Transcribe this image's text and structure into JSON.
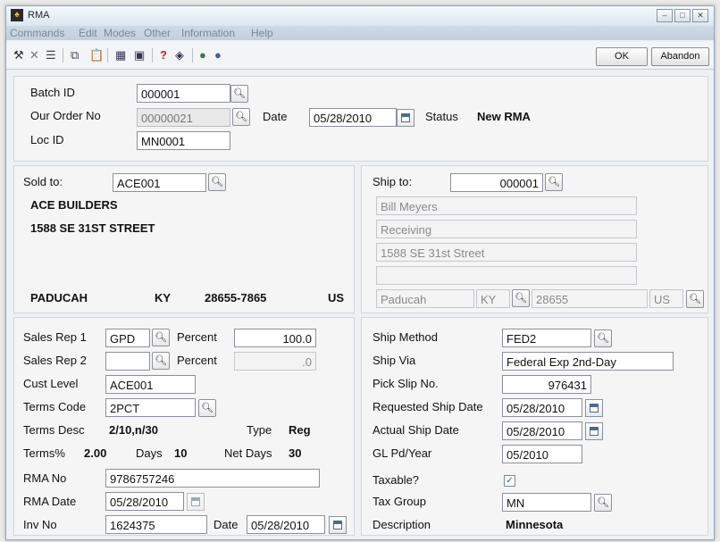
{
  "window": {
    "title": "RMA",
    "icon": "app-icon"
  },
  "menu": [
    "Commands",
    "Edit",
    "Modes",
    "Other",
    "Information",
    "Help"
  ],
  "toolbar": {
    "ok_label": "OK",
    "abandon_label": "Abandon"
  },
  "header": {
    "batch_id_label": "Batch ID",
    "batch_id": "000001",
    "order_no_label": "Our Order No",
    "order_no": "00000021",
    "date_label": "Date",
    "date": "05/28/2010",
    "status_label": "Status",
    "status": "New RMA",
    "loc_id_label": "Loc ID",
    "loc_id": "MN0001"
  },
  "sold_to": {
    "label": "Sold to:",
    "id": "ACE001",
    "name": "ACE BUILDERS",
    "address": "1588 SE 31ST STREET",
    "city": "PADUCAH",
    "state": "KY",
    "zip": "28655-7865",
    "country": "US"
  },
  "ship_to": {
    "label": "Ship to:",
    "id": "000001",
    "line1": "Bill Meyers",
    "line2": "Receiving",
    "line3": "1588 SE 31st Street",
    "line4": "",
    "city": "Paducah",
    "state": "KY",
    "zip": "28655",
    "country": "US"
  },
  "sales": {
    "rep1_label": "Sales Rep 1",
    "rep1": "GPD",
    "percent_label": "Percent",
    "percent1": "100.0",
    "rep2_label": "Sales Rep 2",
    "rep2": "",
    "percent2": ".0",
    "cust_level_label": "Cust Level",
    "cust_level": "ACE001",
    "terms_code_label": "Terms Code",
    "terms_code": "2PCT",
    "terms_desc_label": "Terms Desc",
    "terms_desc": "2/10,n/30",
    "type_label": "Type",
    "type": "Reg",
    "terms_pct_label": "Terms%",
    "terms_pct": "2.00",
    "days_label": "Days",
    "days": "10",
    "net_days_label": "Net Days",
    "net_days": "30",
    "rma_no_label": "RMA No",
    "rma_no": "9786757246",
    "rma_date_label": "RMA Date",
    "rma_date": "05/28/2010",
    "inv_no_label": "Inv No",
    "inv_no": "1624375",
    "inv_date_label": "Date",
    "inv_date": "05/28/2010"
  },
  "shipping": {
    "method_label": "Ship Method",
    "method": "FED2",
    "via_label": "Ship Via",
    "via": "Federal Exp 2nd-Day",
    "pick_slip_label": "Pick Slip No.",
    "pick_slip": "976431",
    "req_date_label": "Requested Ship Date",
    "req_date": "05/28/2010",
    "actual_date_label": "Actual Ship Date",
    "actual_date": "05/28/2010",
    "gl_label": "GL Pd/Year",
    "gl": "05/2010",
    "taxable_label": "Taxable?",
    "taxable": true,
    "tax_group_label": "Tax Group",
    "tax_group": "MN",
    "description_label": "Description",
    "description": "Minnesota"
  }
}
